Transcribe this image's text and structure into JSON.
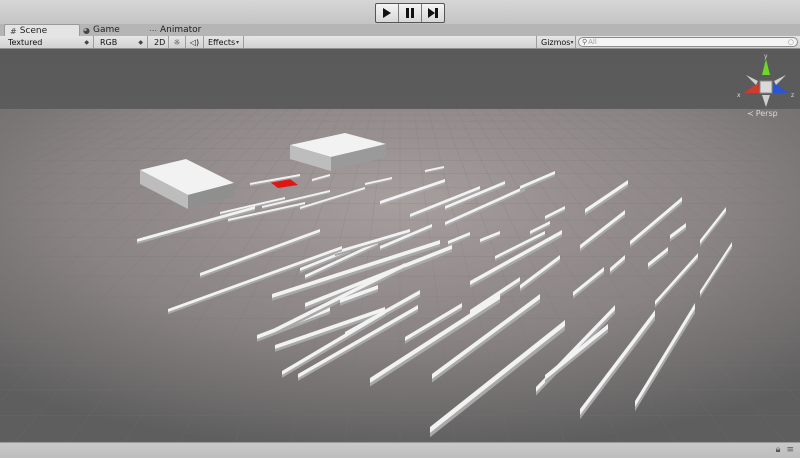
{
  "window": {
    "play_controls": [
      "play",
      "pause",
      "step"
    ]
  },
  "tabs": [
    {
      "label": "Scene",
      "icon": "grid-icon",
      "active": true
    },
    {
      "label": "Game",
      "icon": "pacman-icon",
      "active": false
    },
    {
      "label": "Animator",
      "icon": "animator-icon",
      "active": false
    }
  ],
  "scene_toolbar": {
    "draw_mode": "Textured",
    "render_mode": "RGB",
    "mode_2d": "2D",
    "effects": "Effects",
    "gizmos": "Gizmos",
    "search_placeholder": "All"
  },
  "gizmo": {
    "x_label": "x",
    "y_label": "y",
    "z_label": "z",
    "projection": "Persp",
    "colors": {
      "x": "#d23a2a",
      "y": "#6fd62a",
      "z": "#2a55d6"
    }
  },
  "scene": {
    "background": "#5c5c5c",
    "floor_color": "#8e8888",
    "object_color": "#f2f2f2",
    "highlight_color": "#e01515"
  }
}
